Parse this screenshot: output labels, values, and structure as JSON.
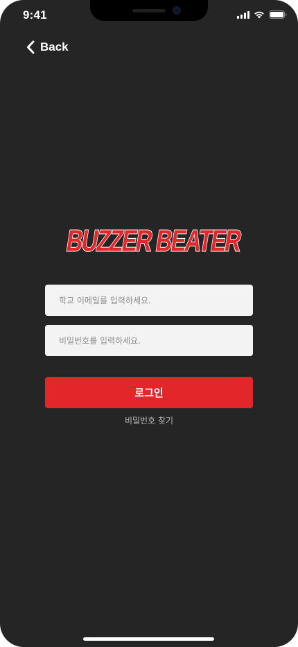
{
  "status_bar": {
    "time": "9:41",
    "icons": [
      "cellular-signal-icon",
      "wifi-icon",
      "battery-icon"
    ]
  },
  "nav": {
    "back_label": "Back",
    "back_icon": "chevron-left-icon"
  },
  "logo": {
    "text": "BUZZER BEATER",
    "fill_color": "#e3262a",
    "outline_color": "#ffffff"
  },
  "form": {
    "email_placeholder": "학교 이메일를 입력하세요.",
    "email_value": "",
    "password_placeholder": "비밀번호를 입력하세요.",
    "password_value": "",
    "login_label": "로그인",
    "find_password_label": "비밀번호 찾기"
  },
  "colors": {
    "background": "#252525",
    "accent": "#e3262a",
    "input_background": "#f4f3f4",
    "secondary_text": "#b9b9b9"
  }
}
